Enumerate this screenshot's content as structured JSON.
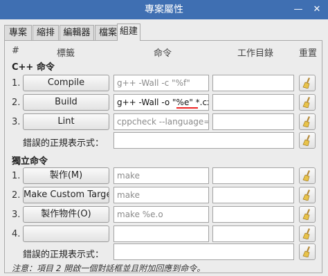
{
  "window": {
    "title": "專案屬性"
  },
  "tabs": [
    "專案",
    "縮排",
    "編輯器",
    "檔案",
    "組建"
  ],
  "columns": {
    "num": "#",
    "label": "標籤",
    "command": "命令",
    "workdir": "工作目錄",
    "reset": "重置"
  },
  "cpp": {
    "heading": "C++ 命令",
    "rows": [
      {
        "num": "1.",
        "label": "Compile",
        "command": "g++ -Wall -c \"%f\"",
        "workdir": ""
      },
      {
        "num": "2.",
        "label": "Build",
        "command": "g++ -Wall -o \"%e\" *.cxx",
        "workdir": ""
      },
      {
        "num": "3.",
        "label": "Lint",
        "command": "cppcheck --language=c++",
        "workdir": ""
      }
    ],
    "regex_label": "錯誤的正規表示式：",
    "regex_value": ""
  },
  "indep": {
    "heading": "獨立命令",
    "rows": [
      {
        "num": "1.",
        "label": "製作(M)",
        "command": "make",
        "workdir": ""
      },
      {
        "num": "2.",
        "label": "Make Custom Target...",
        "command": "make",
        "workdir": ""
      },
      {
        "num": "3.",
        "label": "製作物件(O)",
        "command": "make %e.o",
        "workdir": ""
      },
      {
        "num": "4.",
        "label": "",
        "command": "",
        "workdir": ""
      }
    ],
    "regex_label": "錯誤的正規表示式：",
    "regex_value": ""
  },
  "note": "注意：項目 2 開啟一個對話框並且附加回應到命令。",
  "icons": {
    "minimize": "minimize-icon",
    "close": "close-icon",
    "reset": "broom-icon"
  },
  "colors": {
    "titlebar": "#3f6fb2",
    "annotation": "#e22222"
  }
}
